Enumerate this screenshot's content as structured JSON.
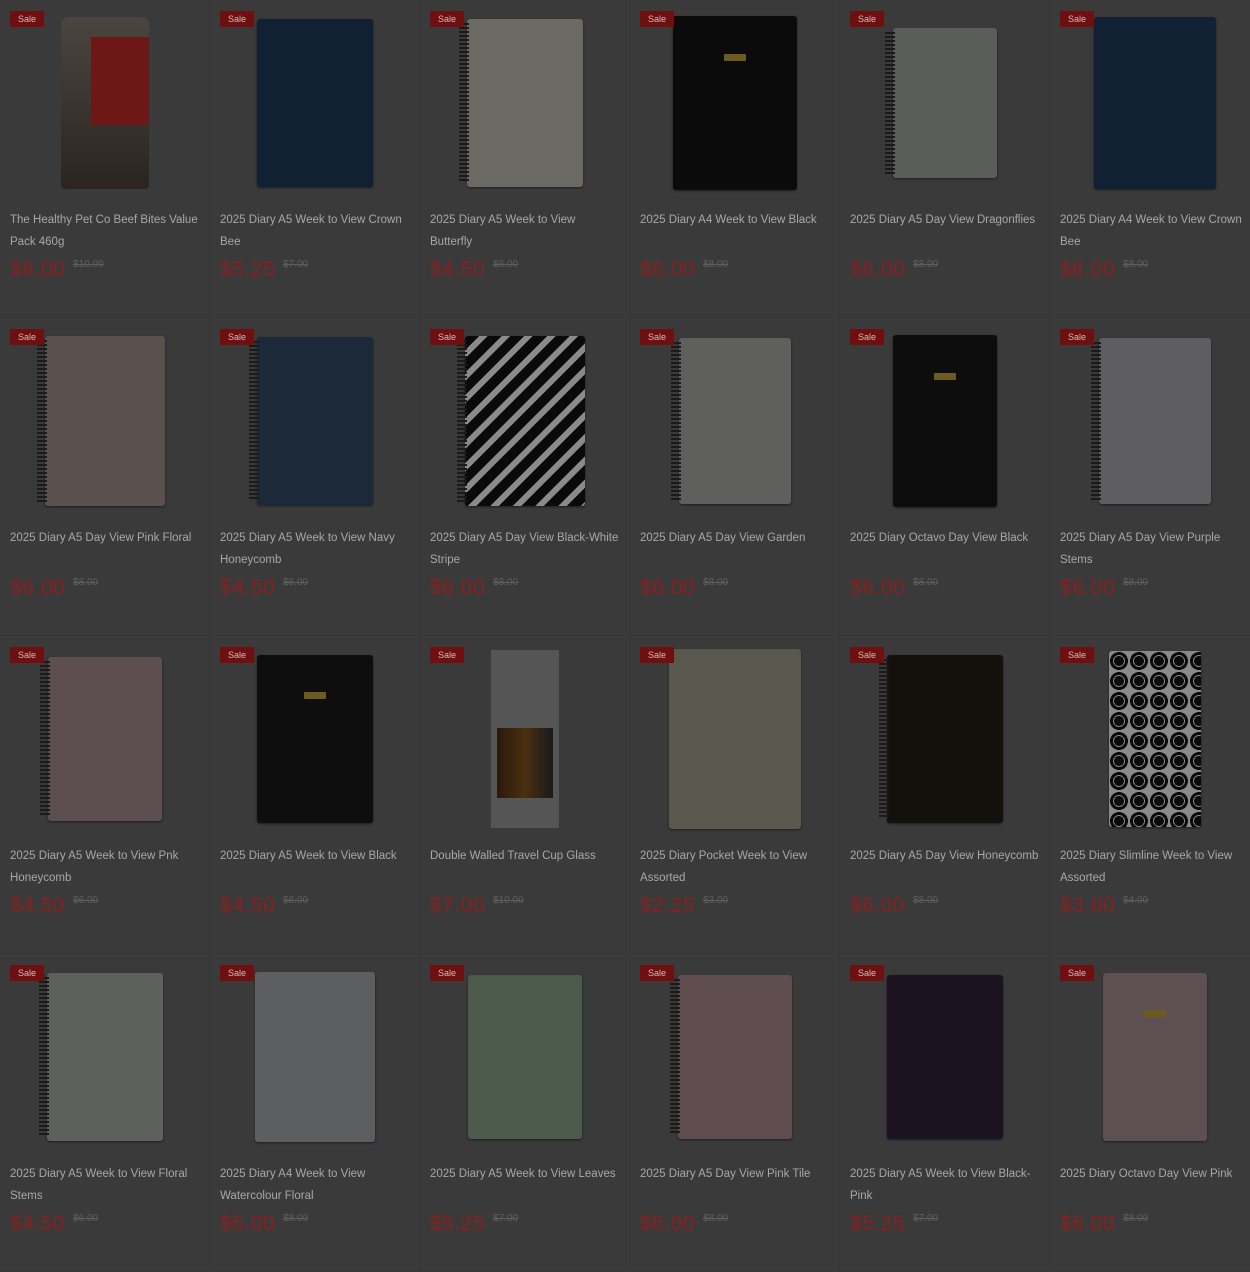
{
  "badge_label": "Sale",
  "products": [
    {
      "title": "The Healthy Pet Co Beef Bites Value Pack 460g",
      "price": "$8.00",
      "old_price": "$10.00",
      "thumb": "bag"
    },
    {
      "title": "2025 Diary A5 Week to View Crown Bee",
      "price": "$5.25",
      "old_price": "$7.00",
      "thumb": "book",
      "color": "#122033",
      "w": 116,
      "h": 168
    },
    {
      "title": "2025 Diary A5 Week to View Butterfly",
      "price": "$4.50",
      "old_price": "$6.00",
      "thumb": "book",
      "color": "#6a6a62",
      "w": 116,
      "h": 168,
      "spiral": true
    },
    {
      "title": "2025 Diary A4 Week to View Black",
      "price": "$6.00",
      "old_price": "$8.00",
      "thumb": "book",
      "color": "#0b0b0b",
      "w": 124,
      "h": 174,
      "plate": true
    },
    {
      "title": "2025 Diary A5 Day View Dragonflies",
      "price": "$6.00",
      "old_price": "$8.00",
      "thumb": "book",
      "color": "#5a5d5a",
      "w": 104,
      "h": 150,
      "spiral": true
    },
    {
      "title": "2025 Diary A4 Week to View Crown Bee",
      "price": "$6.00",
      "old_price": "$8.00",
      "thumb": "book",
      "color": "#122033",
      "w": 122,
      "h": 172
    },
    {
      "title": "2025 Diary A5 Day View Pink Floral",
      "price": "$6.00",
      "old_price": "$8.00",
      "thumb": "book",
      "color": "#5a504e",
      "w": 120,
      "h": 170,
      "spiral": true
    },
    {
      "title": "2025 Diary A5 Week to View Navy Honeycomb",
      "price": "$4.50",
      "old_price": "$6.00",
      "thumb": "book",
      "color": "#1c2938",
      "w": 116,
      "h": 168,
      "spiral": true
    },
    {
      "title": "2025 Diary A5 Day View Black-White Stripe",
      "price": "$6.00",
      "old_price": "$8.00",
      "thumb": "stripes",
      "w": 120,
      "h": 170,
      "spiral": true
    },
    {
      "title": "2025 Diary A5 Day View Garden",
      "price": "$6.00",
      "old_price": "$8.00",
      "thumb": "book",
      "color": "#5f605e",
      "w": 112,
      "h": 166,
      "spiral": true
    },
    {
      "title": "2025 Diary Octavo Day View Black",
      "price": "$6.00",
      "old_price": "$8.00",
      "thumb": "book",
      "color": "#0d0d0d",
      "w": 104,
      "h": 172,
      "plate": true
    },
    {
      "title": "2025 Diary A5 Day View Purple Stems",
      "price": "$6.00",
      "old_price": "$8.00",
      "thumb": "book",
      "color": "#5e5d62",
      "w": 112,
      "h": 166,
      "spiral": true
    },
    {
      "title": "2025 Diary A5 Week to View Pnk Honeycomb",
      "price": "$4.50",
      "old_price": "$6.00",
      "thumb": "book",
      "color": "#5d4e50",
      "w": 114,
      "h": 164,
      "spiral": true
    },
    {
      "title": "2025 Diary A5 Week to View Black",
      "price": "$4.50",
      "old_price": "$6.00",
      "thumb": "book",
      "color": "#0e0e0e",
      "w": 116,
      "h": 168,
      "plate": true
    },
    {
      "title": "Double Walled Travel Cup Glass",
      "price": "$7.00",
      "old_price": "$10.00",
      "thumb": "cup"
    },
    {
      "title": "2025 Diary Pocket Week to View Assorted",
      "price": "$2.25",
      "old_price": "$3.00",
      "thumb": "book",
      "color": "#58584e",
      "w": 132,
      "h": 180
    },
    {
      "title": "2025 Diary A5 Day View Honeycomb",
      "price": "$6.00",
      "old_price": "$8.00",
      "thumb": "book",
      "color": "#14110d",
      "w": 116,
      "h": 168,
      "spiral": true
    },
    {
      "title": "2025 Diary Slimline Week to View Assorted",
      "price": "$3.00",
      "old_price": "$4.00",
      "thumb": "hex",
      "w": 92,
      "h": 176
    },
    {
      "title": "2025 Diary A5 Week to View Floral Stems",
      "price": "$4.50",
      "old_price": "$6.00",
      "thumb": "book",
      "color": "#5e605b",
      "w": 116,
      "h": 168,
      "spiral": true
    },
    {
      "title": "2025 Diary A4 Week to View Watercolour Floral",
      "price": "$6.00",
      "old_price": "$8.00",
      "thumb": "book",
      "color": "#5d5e61",
      "w": 120,
      "h": 170
    },
    {
      "title": "2025 Diary A5 Week to View Leaves",
      "price": "$5.25",
      "old_price": "$7.00",
      "thumb": "book",
      "color": "#4c5a4c",
      "w": 114,
      "h": 164
    },
    {
      "title": "2025 Diary A5 Day View Pink Tile",
      "price": "$6.00",
      "old_price": "$8.00",
      "thumb": "book",
      "color": "#5f4d4f",
      "w": 114,
      "h": 164,
      "spiral": true
    },
    {
      "title": "2025 Diary A5 Week to View Black-Pink",
      "price": "$5.25",
      "old_price": "$7.00",
      "thumb": "book",
      "color": "#1d1220",
      "w": 116,
      "h": 164
    },
    {
      "title": "2025 Diary Octavo Day View Pink",
      "price": "$6.00",
      "old_price": "$8.00",
      "thumb": "book",
      "color": "#5d5053",
      "w": 104,
      "h": 168,
      "plate": true
    }
  ]
}
